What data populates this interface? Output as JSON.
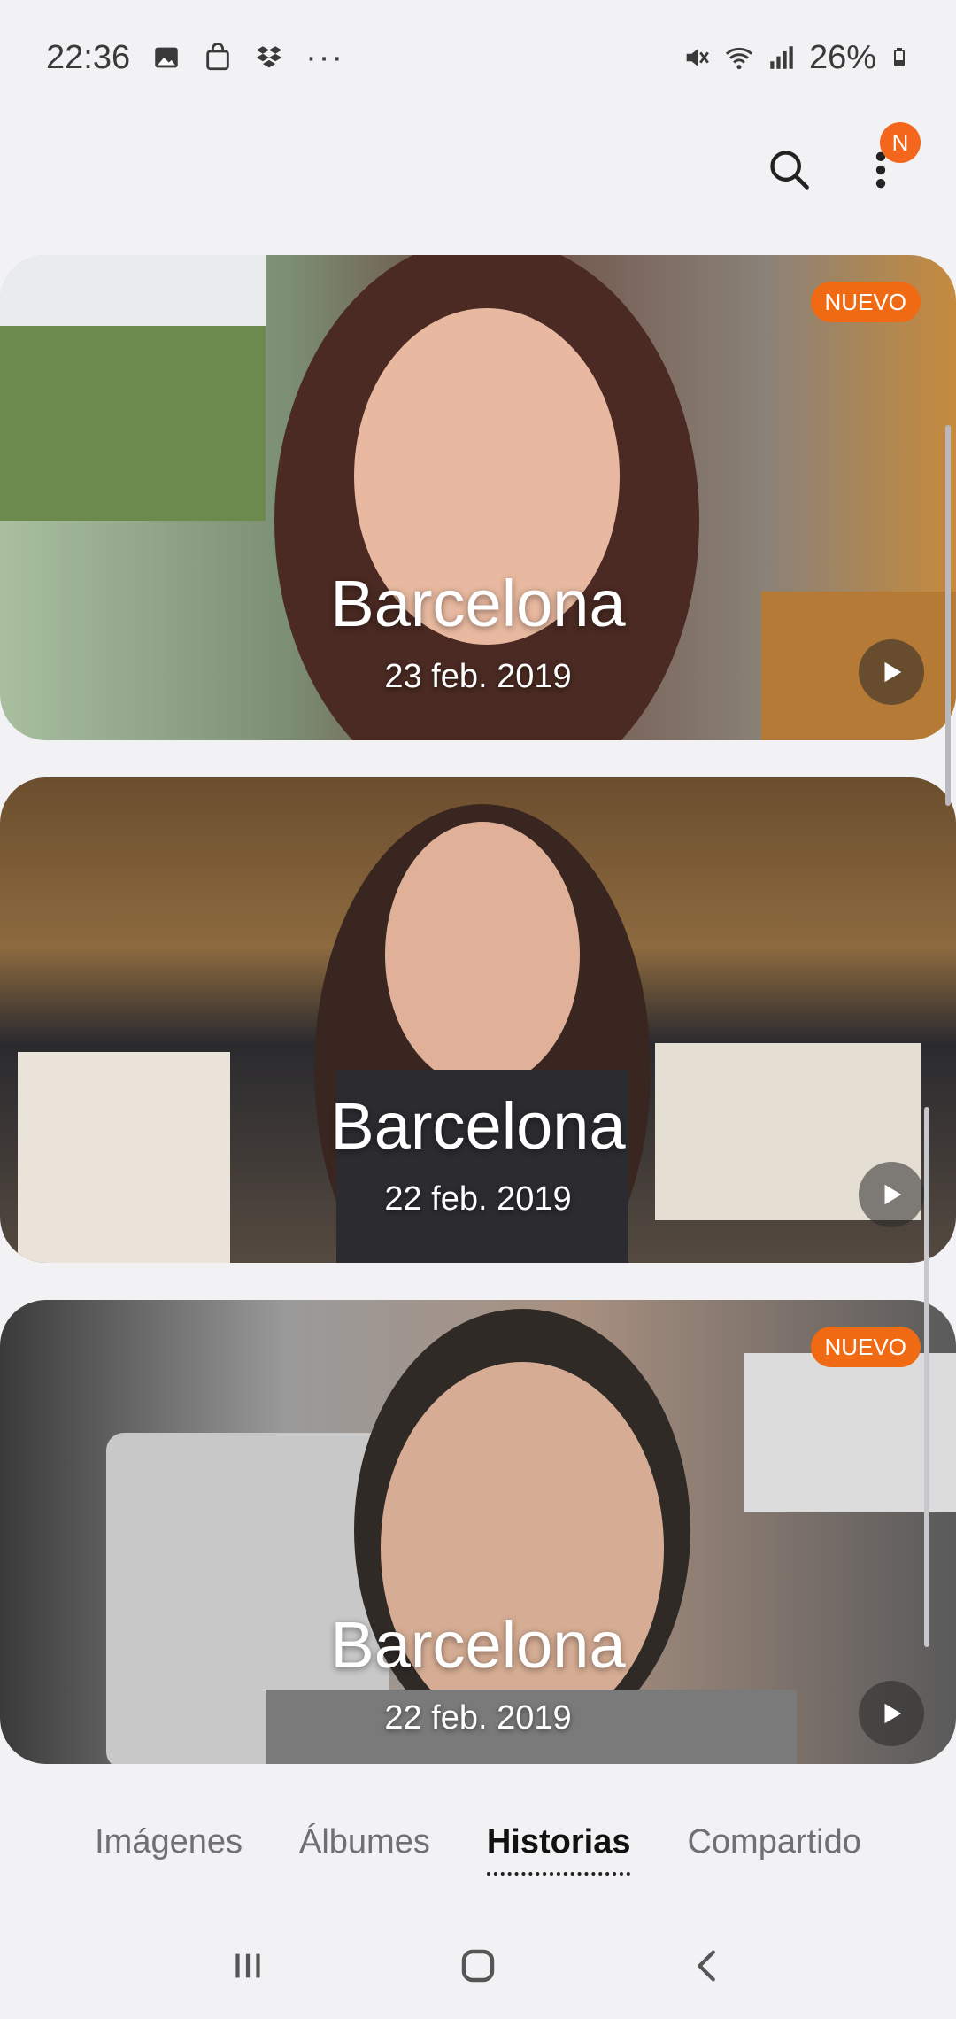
{
  "status_bar": {
    "time": "22:36",
    "left_icons": [
      "gallery-icon",
      "bag-icon",
      "dropbox-icon",
      "more-dots-icon"
    ],
    "right_icons": [
      "mute-icon",
      "wifi-icon",
      "signal-icon"
    ],
    "battery": "26%"
  },
  "app_bar": {
    "search_icon": "search-icon",
    "more_icon": "more-vertical-icon",
    "notification_badge": "N"
  },
  "stories": [
    {
      "title": "Barcelona",
      "date": "23 feb. 2019",
      "badge": "NUEVO",
      "play_icon": "play-icon"
    },
    {
      "title": "Barcelona",
      "date": "22 feb. 2019",
      "badge": "",
      "play_icon": "play-icon"
    },
    {
      "title": "Barcelona",
      "date": "22 feb. 2019",
      "badge": "NUEVO",
      "play_icon": "play-icon"
    }
  ],
  "tabs": [
    {
      "label": "Imágenes",
      "active": false
    },
    {
      "label": "Álbumes",
      "active": false
    },
    {
      "label": "Historias",
      "active": true
    },
    {
      "label": "Compartido",
      "active": false
    }
  ],
  "nav": [
    "recents-icon",
    "home-icon",
    "back-icon"
  ],
  "colors": {
    "accent": "#f06a14",
    "background": "#f2f2f4"
  }
}
